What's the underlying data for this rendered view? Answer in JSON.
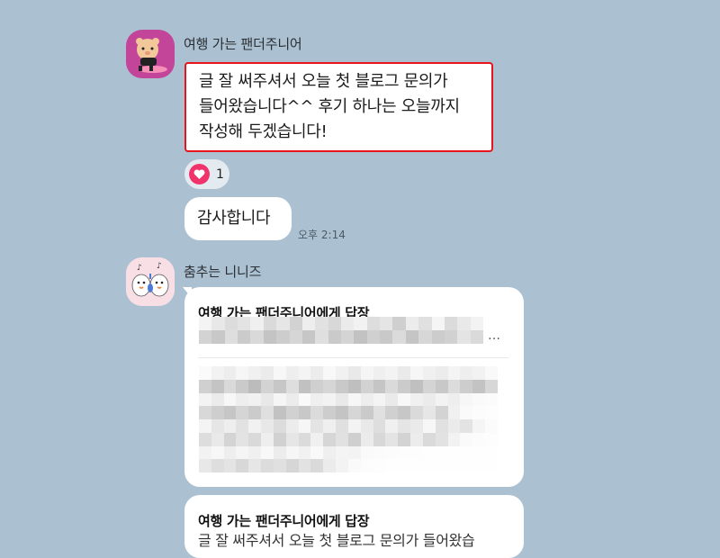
{
  "messages": [
    {
      "sender": "여행 가는 팬더주니어",
      "avatar_icon": "panda-avatar-icon",
      "lines": [
        "글 잘 써주셔서 오늘 첫 블로그 문의가",
        "들어왔습니다^^ 후기 하나는 오늘까지",
        "작성해 두겠습니다!"
      ],
      "highlight_color": "#e8141c",
      "reaction": {
        "icon": "heart-icon",
        "count": "1",
        "color": "#f0336a"
      }
    },
    {
      "sender": "",
      "text": "감사합니다",
      "time": "오후 2:14"
    },
    {
      "sender": "춤추는 니니즈",
      "avatar_icon": "dancing-niniz-avatar-icon",
      "replies": [
        {
          "title": "여행 가는 팬더주니어에게 답장",
          "quoted": "…",
          "body_state": "blurred"
        },
        {
          "title": "여행 가는 팬더주니어에게 답장",
          "quoted_partial": "글 잘 써주셔서 오늘 첫 블로그 문의가 들어왔습"
        }
      ]
    }
  ],
  "colors": {
    "background": "#abc1d1",
    "bubble": "#ffffff"
  }
}
